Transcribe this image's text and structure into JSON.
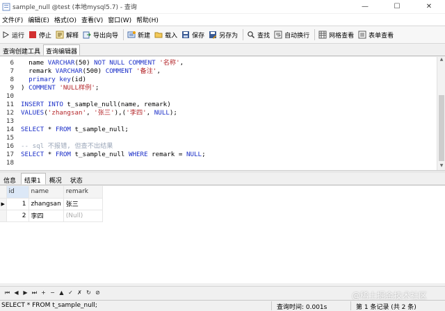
{
  "window": {
    "title": "sample_null @test (本地mysql5.7) - 查询",
    "controls": [
      "—",
      "☐",
      "✕"
    ]
  },
  "menu": [
    "文件(F)",
    "编辑(E)",
    "格式(O)",
    "查看(V)",
    "窗口(W)",
    "帮助(H)"
  ],
  "toolbar": {
    "run": "运行",
    "stop": "停止",
    "explain": "解释",
    "export_wizard": "导出向导",
    "new": "新建",
    "load": "载入",
    "save": "保存",
    "save_as": "另存为",
    "find": "查找",
    "auto_wrap": "自动换行",
    "grid_view": "网格查看",
    "form_view": "表单查看"
  },
  "editor_tabs": [
    "查询创建工具",
    "查询编辑器"
  ],
  "editor": {
    "lines": [
      {
        "n": "6",
        "tokens": [
          {
            "t": "  name ",
            "c": "plain"
          },
          {
            "t": "VARCHAR",
            "c": "kw"
          },
          {
            "t": "(50) ",
            "c": "plain"
          },
          {
            "t": "NOT NULL COMMENT ",
            "c": "kw"
          },
          {
            "t": "'名称'",
            "c": "str"
          },
          {
            "t": ",",
            "c": "plain"
          }
        ]
      },
      {
        "n": "7",
        "tokens": [
          {
            "t": "  remark ",
            "c": "plain"
          },
          {
            "t": "VARCHAR",
            "c": "kw"
          },
          {
            "t": "(500) ",
            "c": "plain"
          },
          {
            "t": "COMMENT ",
            "c": "kw"
          },
          {
            "t": "'备注'",
            "c": "str"
          },
          {
            "t": ",",
            "c": "plain"
          }
        ]
      },
      {
        "n": "8",
        "tokens": [
          {
            "t": "  ",
            "c": "plain"
          },
          {
            "t": "primary key",
            "c": "kw"
          },
          {
            "t": "(id)",
            "c": "plain"
          }
        ]
      },
      {
        "n": "9",
        "tokens": [
          {
            "t": ") ",
            "c": "plain"
          },
          {
            "t": "COMMENT ",
            "c": "kw"
          },
          {
            "t": "'NULL样例'",
            "c": "str"
          },
          {
            "t": ";",
            "c": "plain"
          }
        ]
      },
      {
        "n": "10",
        "tokens": []
      },
      {
        "n": "11",
        "tokens": [
          {
            "t": "INSERT INTO ",
            "c": "kw"
          },
          {
            "t": "t_sample_null(name, remark)",
            "c": "plain"
          }
        ]
      },
      {
        "n": "12",
        "tokens": [
          {
            "t": "VALUES",
            "c": "kw"
          },
          {
            "t": "(",
            "c": "plain"
          },
          {
            "t": "'zhangsan'",
            "c": "str"
          },
          {
            "t": ", ",
            "c": "plain"
          },
          {
            "t": "'张三'",
            "c": "str"
          },
          {
            "t": "),(",
            "c": "plain"
          },
          {
            "t": "'李四'",
            "c": "str"
          },
          {
            "t": ", ",
            "c": "plain"
          },
          {
            "t": "NULL",
            "c": "kw"
          },
          {
            "t": ");",
            "c": "plain"
          }
        ]
      },
      {
        "n": "13",
        "tokens": []
      },
      {
        "n": "14",
        "tokens": [
          {
            "t": "SELECT ",
            "c": "kw"
          },
          {
            "t": "* ",
            "c": "plain"
          },
          {
            "t": "FROM ",
            "c": "kw"
          },
          {
            "t": "t_sample_null;",
            "c": "plain"
          }
        ]
      },
      {
        "n": "15",
        "tokens": []
      },
      {
        "n": "16",
        "tokens": [
          {
            "t": "-- sql 不报错, 但查不出结果",
            "c": "cmt"
          }
        ]
      },
      {
        "n": "17",
        "tokens": [
          {
            "t": "SELECT ",
            "c": "kw"
          },
          {
            "t": "* ",
            "c": "plain"
          },
          {
            "t": "FROM ",
            "c": "kw"
          },
          {
            "t": "t_sample_null ",
            "c": "plain"
          },
          {
            "t": "WHERE ",
            "c": "kw"
          },
          {
            "t": "remark = ",
            "c": "plain"
          },
          {
            "t": "NULL",
            "c": "kw"
          },
          {
            "t": ";",
            "c": "plain"
          }
        ]
      },
      {
        "n": "18",
        "tokens": []
      }
    ]
  },
  "result_tabs": [
    "信息",
    "结果1",
    "概况",
    "状态"
  ],
  "grid": {
    "columns": [
      "id",
      "name",
      "remark"
    ],
    "rows": [
      {
        "id": "1",
        "name": "zhangsan",
        "remark": "张三",
        "null_remark": false
      },
      {
        "id": "2",
        "name": "李四",
        "remark": "(Null)",
        "null_remark": true
      }
    ]
  },
  "nav_buttons": [
    "⏮",
    "◀",
    "▶",
    "⏭",
    "+",
    "−",
    "▲",
    "✓",
    "✗",
    "↻",
    "⊘"
  ],
  "status": {
    "sql": "SELECT * FROM t_sample_null;",
    "query_time": "查询时间: 0.001s",
    "record_count": "第 1 条记录 (共 2 条)"
  },
  "watermark": "@稀土掘金技术社区",
  "colors": {
    "keyword": "#1a2ec8",
    "string": "#b4262a",
    "comment": "#9aa6b8"
  }
}
